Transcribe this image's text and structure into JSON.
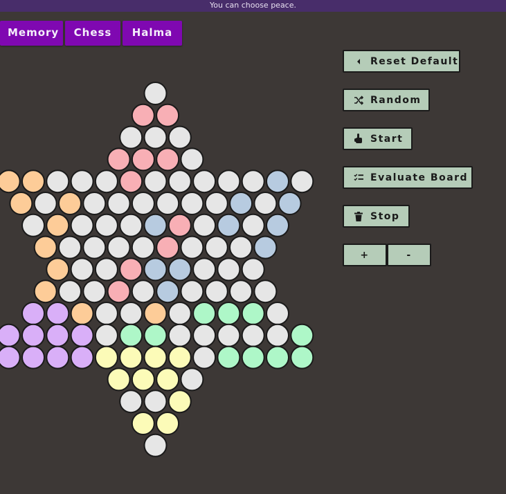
{
  "banner": {
    "text": "You can choose peace."
  },
  "tabs": [
    {
      "label": "Memory"
    },
    {
      "label": "Chess"
    },
    {
      "label": "Halma"
    }
  ],
  "controls": {
    "reset": {
      "label": "Reset Default",
      "icon": "caret-left-icon"
    },
    "random": {
      "label": "Random",
      "icon": "shuffle-icon"
    },
    "start": {
      "label": "Start",
      "icon": "hand-pointer-icon"
    },
    "evaluate": {
      "label": "Evaluate Board",
      "icon": "checklist-icon"
    },
    "stop": {
      "label": "Stop",
      "icon": "trash-icon"
    },
    "plus": {
      "label": "+"
    },
    "minus": {
      "label": "-"
    }
  },
  "colors": {
    "empty": "#e6e6e6",
    "pink": "#f8afb5",
    "orange": "#fdcc98",
    "blue": "#b7cbe0",
    "purple": "#d9aff8",
    "green": "#aef7c8",
    "yellow": "#fcfbb8",
    "tab": "#7f08b1",
    "button": "#b5ccb8",
    "banner": "#482d6a",
    "background": "#3d3836"
  },
  "board": {
    "rows": [
      "W",
      "PP",
      "WWW",
      "PPPW",
      "OOWWWPWWWWWBW",
      "OWOWWWWWWBWB",
      "WOWWWBPWBWB",
      "OWWWWPWWWB",
      "OWWPBBWWW",
      "OWWPWBWWWW",
      "UUOWWOWGGGW",
      "UUUUWGGWWWWWG",
      "UUUUYYYYWGGGG",
      "YYYW",
      "WWY",
      "YY",
      "W"
    ]
  }
}
